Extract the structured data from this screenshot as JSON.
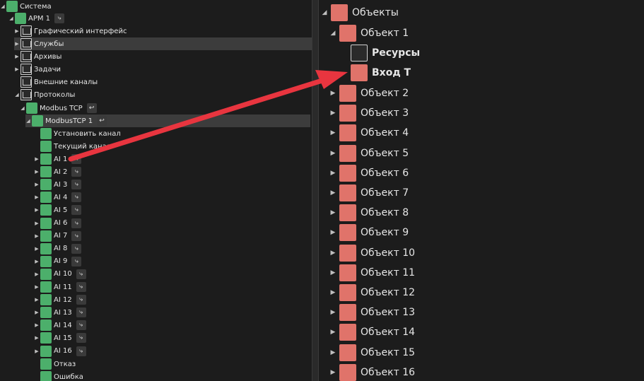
{
  "left_tree": {
    "system": "Система",
    "arm": "АРМ 1",
    "graphic": "Графический интерфейс",
    "services": "Службы",
    "archives": "Архивы",
    "tasks": "Задачи",
    "ext_channels": "Внешние каналы",
    "protocols": "Протоколы",
    "modbus_tcp": "Modbus TCP",
    "modbus_tcp1": "ModbusTCP 1",
    "set_channel": "Установить канал",
    "current_channel": "Текущий канал",
    "ai_items": [
      "AI 1",
      "AI 2",
      "AI 3",
      "AI 4",
      "AI 5",
      "AI 6",
      "AI 7",
      "AI 8",
      "AI 9",
      "AI 10",
      "AI 11",
      "AI 12",
      "AI 13",
      "AI 14",
      "AI 15",
      "AI 16"
    ],
    "fail": "Отказ",
    "error": "Ошибка"
  },
  "right_tree": {
    "objects": "Объекты",
    "object1": "Объект 1",
    "resources": "Ресурсы",
    "input_t": "Вход Т",
    "objects_list": [
      "Объект 2",
      "Объект 3",
      "Объект 4",
      "Объект 5",
      "Объект 6",
      "Объект 7",
      "Объект 8",
      "Объект 9",
      "Объект 10",
      "Объект 11",
      "Объект 12",
      "Объект 13",
      "Объект 14",
      "Объект 15",
      "Объект 16"
    ]
  },
  "colors": {
    "green_icon": "#4caf6b",
    "red_icon": "#e0736a",
    "arrow": "#e8353f"
  }
}
